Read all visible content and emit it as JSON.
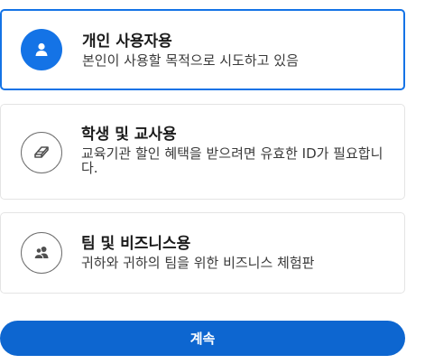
{
  "options": [
    {
      "title": "개인 사용자용",
      "description": "본인이 사용할 목적으로 시도하고 있음",
      "icon": "user-icon",
      "selected": true
    },
    {
      "title": "학생 및 교사용",
      "description": "교육기관 할인 혜택을 받으려면 유효한 ID가 필요합니다.",
      "icon": "eraser-icon",
      "selected": false
    },
    {
      "title": "팀 및 비즈니스용",
      "description": "귀하와 귀하의 팀을 위한 비즈니스 체험판",
      "icon": "team-icon",
      "selected": false
    }
  ],
  "continue_label": "계속",
  "colors": {
    "accent": "#1473e6",
    "button": "#0d66d0",
    "icon_outline": "#6e6e6e"
  }
}
